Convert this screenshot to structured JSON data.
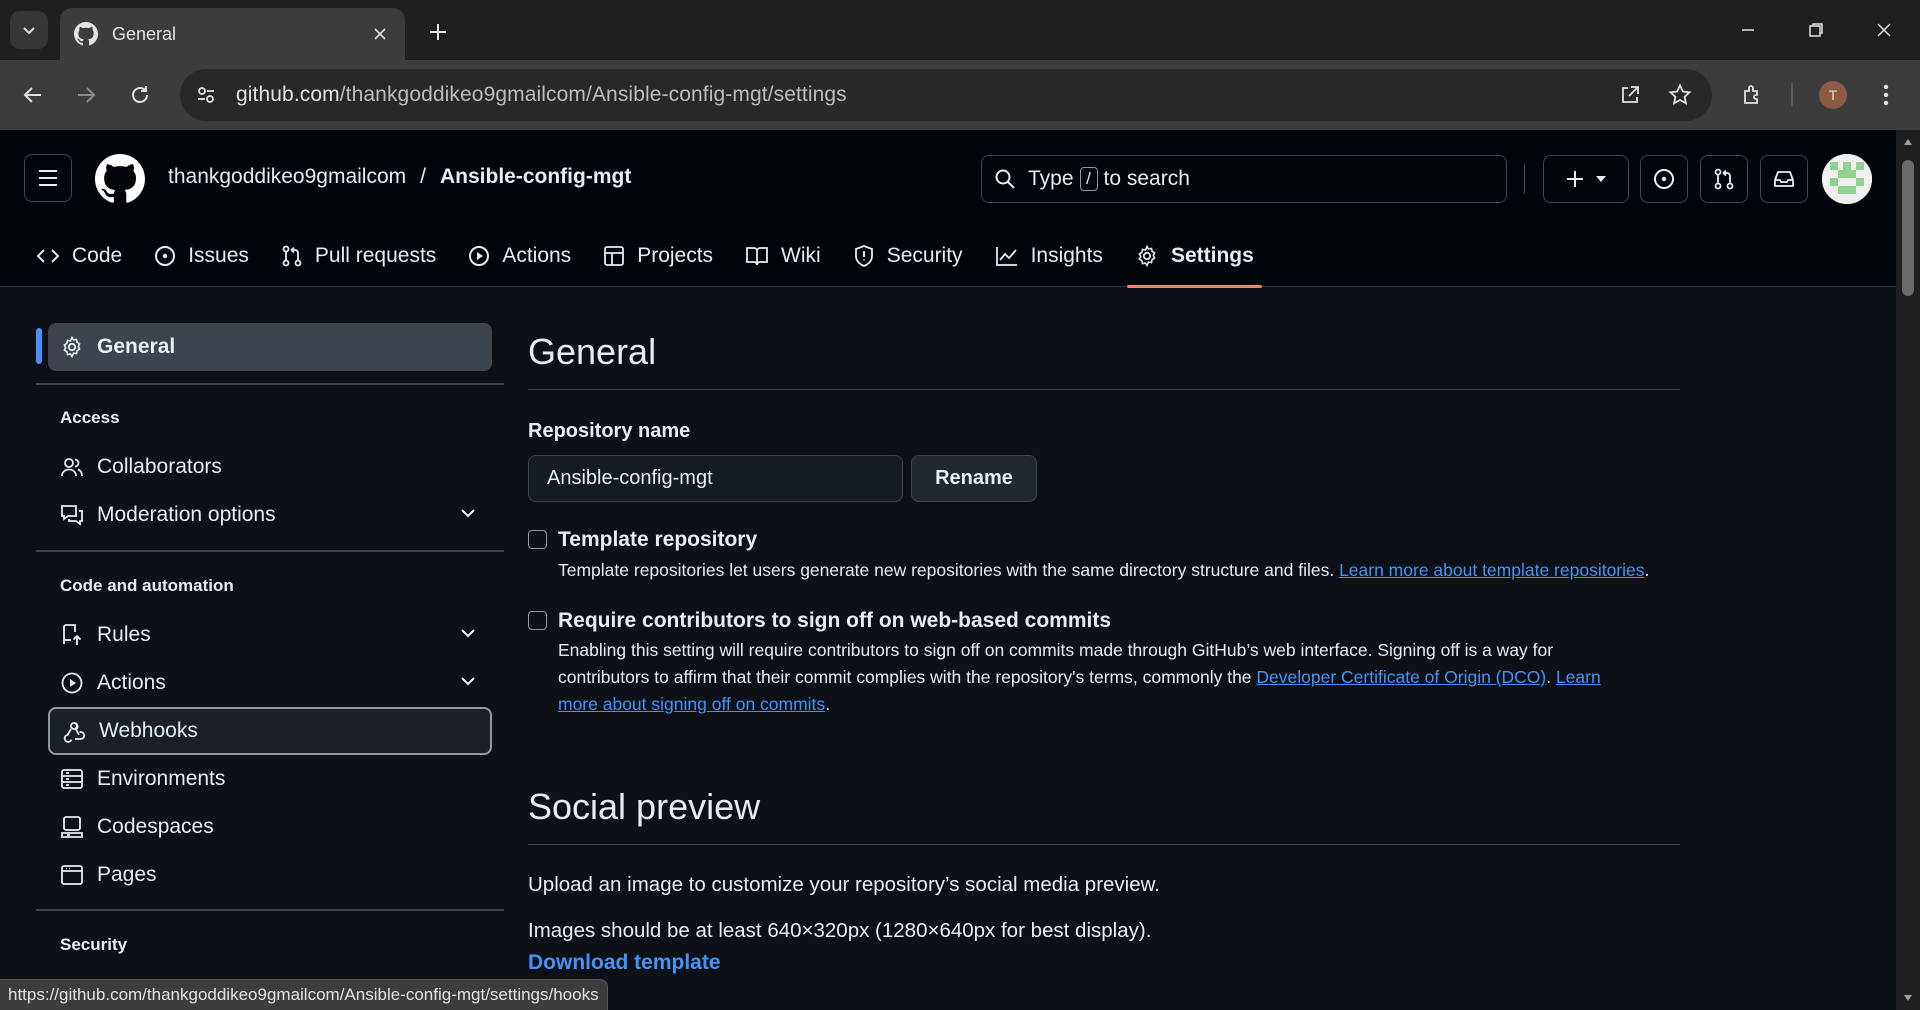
{
  "browser": {
    "tab_title": "General",
    "url_host": "github.com",
    "url_path": "/thankgoddikeo9gmailcom/Ansible-config-mgt/settings",
    "profile_initial": "T",
    "status_url": "https://github.com/thankgoddikeo9gmailcom/Ansible-config-mgt/settings/hooks"
  },
  "header": {
    "owner": "thankgoddikeo9gmailcom",
    "separator": "/",
    "repo": "Ansible-config-mgt",
    "search_prefix": "Type",
    "search_key": "/",
    "search_suffix": "to search"
  },
  "repo_nav": [
    {
      "label": "Code",
      "icon": "code-icon"
    },
    {
      "label": "Issues",
      "icon": "issue-icon"
    },
    {
      "label": "Pull requests",
      "icon": "pull-request-icon"
    },
    {
      "label": "Actions",
      "icon": "play-icon"
    },
    {
      "label": "Projects",
      "icon": "table-icon"
    },
    {
      "label": "Wiki",
      "icon": "book-icon"
    },
    {
      "label": "Security",
      "icon": "shield-icon"
    },
    {
      "label": "Insights",
      "icon": "graph-icon"
    },
    {
      "label": "Settings",
      "icon": "gear-icon",
      "selected": true
    }
  ],
  "sidebar": {
    "general": "General",
    "access_heading": "Access",
    "collaborators": "Collaborators",
    "moderation": "Moderation options",
    "code_heading": "Code and automation",
    "rules": "Rules",
    "actions": "Actions",
    "webhooks": "Webhooks",
    "environments": "Environments",
    "codespaces": "Codespaces",
    "pages": "Pages",
    "security_heading": "Security"
  },
  "main": {
    "title": "General",
    "repo_name_label": "Repository name",
    "repo_name_value": "Ansible-config-mgt",
    "rename_button": "Rename",
    "template_title": "Template repository",
    "template_desc": "Template repositories let users generate new repositories with the same directory structure and files. ",
    "template_link": "Learn more about template repositories",
    "signoff_title": "Require contributors to sign off on web-based commits",
    "signoff_desc_1": "Enabling this setting will require contributors to sign off on commits made through GitHub’s web interface. Signing off is a way for contributors to affirm that their commit complies with the repository's terms, commonly the ",
    "signoff_link_dco": "Developer Certificate of Origin (DCO)",
    "signoff_link_learn": "Learn more about signing off on commits",
    "social_title": "Social preview",
    "social_desc": "Upload an image to customize your repository’s social media preview.",
    "social_size": "Images should be at least 640×320px (1280×640px for best display).",
    "download_template": "Download template"
  },
  "colors": {
    "accent_link": "#4493f8",
    "selected_underline": "#f78166",
    "background": "#0d1117"
  }
}
